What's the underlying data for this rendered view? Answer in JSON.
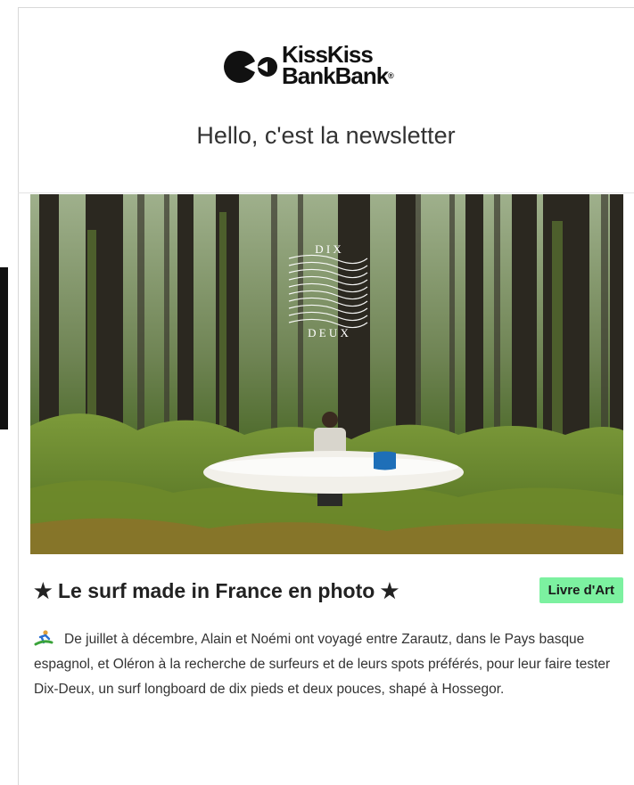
{
  "header": {
    "logo_line1": "KissKiss",
    "logo_line2": "BankBank",
    "logo_reg": "®",
    "tagline": "Hello, c'est la newsletter"
  },
  "hero": {
    "image_icon": "forest-surfer-photo",
    "watermark_top": "D I X",
    "watermark_bottom": "D E U X"
  },
  "article": {
    "title": "★ Le surf made in France en photo ★",
    "category": "Livre d'Art",
    "intro_icon": "surfer-emoji-icon",
    "body": "De juillet à décembre, Alain et Noémi ont voyagé entre Zarautz, dans le Pays basque espagnol, et Oléron à la recherche de surfeurs et de leurs spots préférés, pour leur faire tester Dix-Deux, un surf longboard de dix pieds et deux pouces, shapé à Hossegor."
  },
  "colors": {
    "badge": "#7cf1a0",
    "text": "#333333"
  }
}
